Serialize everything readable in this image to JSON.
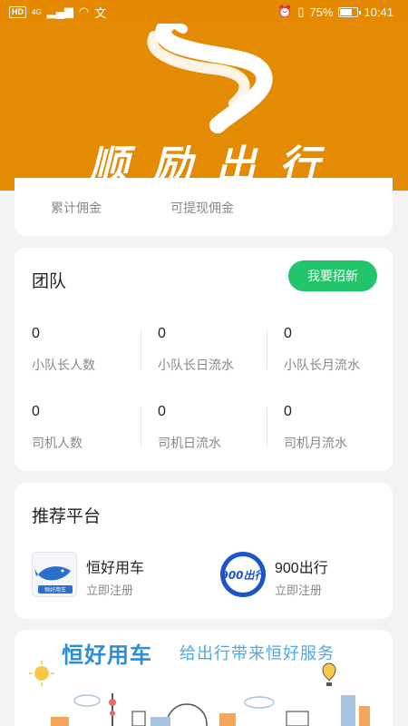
{
  "status_bar": {
    "network_badge": "HD",
    "network_type": "4G",
    "battery_percent": "75%",
    "battery_level": 0.75,
    "time": "10:41"
  },
  "banner": {
    "brand": "顺励出行",
    "background_color": "#e38b05"
  },
  "commission": {
    "labels": [
      "累计佣金",
      "可提现佣金"
    ]
  },
  "team": {
    "title": "团队",
    "recruit_button": "我要招新",
    "accent_color": "#22c569",
    "stats": [
      {
        "value": "0",
        "label": "小队长人数"
      },
      {
        "value": "0",
        "label": "小队长日流水"
      },
      {
        "value": "0",
        "label": "小队长月流水"
      },
      {
        "value": "0",
        "label": "司机人数"
      },
      {
        "value": "0",
        "label": "司机日流水"
      },
      {
        "value": "0",
        "label": "司机月流水"
      }
    ]
  },
  "platforms": {
    "title": "推荐平台",
    "items": [
      {
        "name": "恒好用车",
        "action": "立即注册",
        "logo_icon": "whale-logo-icon",
        "logo_text": "恒好用车"
      },
      {
        "name": "900出行",
        "action": "立即注册",
        "logo_icon": "900-logo-icon",
        "logo_text": "900出行"
      }
    ]
  },
  "promo_banner": {
    "title": "恒好用车",
    "slogan": "给出行带来恒好服务",
    "color": "#2a8fd8"
  }
}
